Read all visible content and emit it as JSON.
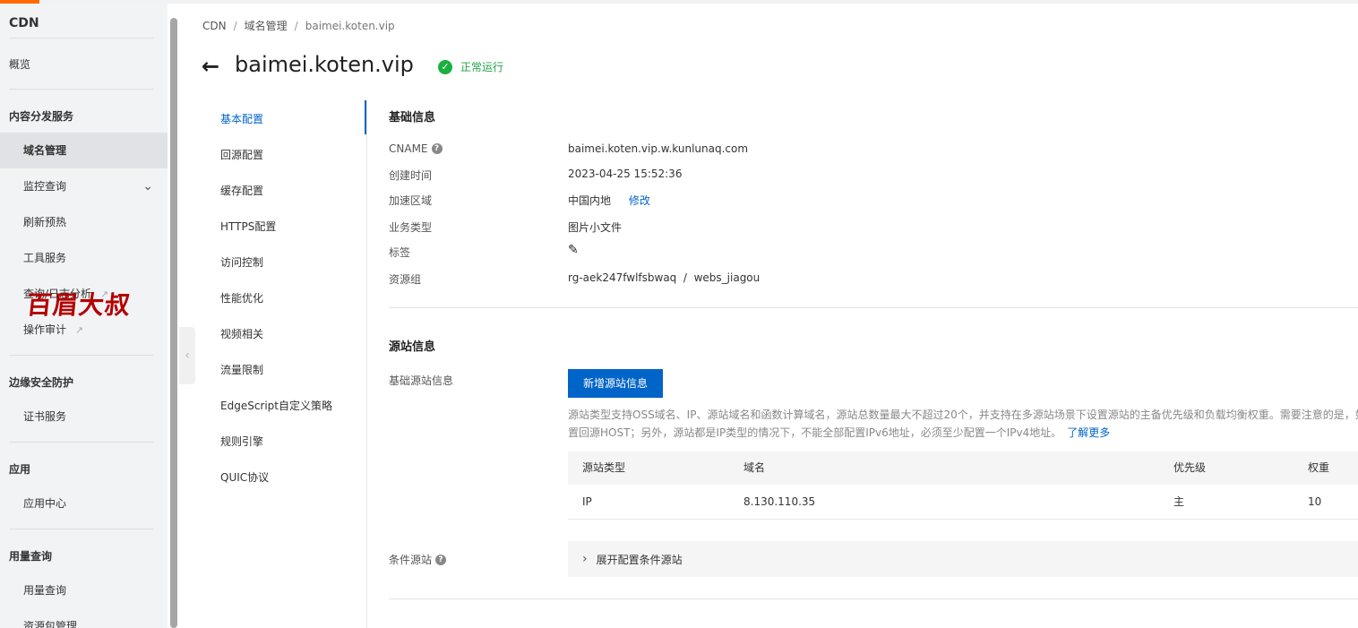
{
  "sidebar": {
    "title": "CDN",
    "overview": "概览",
    "groups": {
      "content": "内容分发服务",
      "edge": "边缘安全防护",
      "apps": "应用",
      "usage": "用量查询"
    },
    "items": {
      "domain": "域名管理",
      "monitor": "监控查询",
      "refresh": "刷新预热",
      "tools": "工具服务",
      "log": "查询/日志分析",
      "audit": "操作审计",
      "cert": "证书服务",
      "appcenter": "应用中心",
      "usagequery": "用量查询",
      "resource": "资源包管理"
    },
    "watermark": "百眉大叔"
  },
  "breadcrumb": {
    "root": "CDN",
    "mid": "域名管理",
    "current": "baimei.koten.vip"
  },
  "header": {
    "title": "baimei.koten.vip",
    "status": "正常运行",
    "status_color": "#1ab03e"
  },
  "config_nav": [
    "基本配置",
    "回源配置",
    "缓存配置",
    "HTTPS配置",
    "访问控制",
    "性能优化",
    "视频相关",
    "流量限制",
    "EdgeScript自定义策略",
    "规则引擎",
    "QUIC协议"
  ],
  "basic": {
    "title": "基础信息",
    "labels": {
      "cname": "CNAME",
      "created": "创建时间",
      "region": "加速区域",
      "biz": "业务类型",
      "tags": "标签",
      "rg": "资源组"
    },
    "values": {
      "cname": "baimei.koten.vip.w.kunlunaq.com",
      "created": "2023-04-25 15:52:36",
      "region": "中国内地",
      "region_edit": "修改",
      "biz": "图片小文件",
      "rg": "rg-aek247fwlfsbwaq  /  webs_jiagou"
    }
  },
  "origin": {
    "title": "源站信息",
    "basic_label": "基础源站信息",
    "add_button": "新增源站信息",
    "desc_line1": "源站类型支持OSS域名、IP、源站域名和函数计算域名，源站总数量最大不超过20个，并支持在多源站场景下设置源站的主备优先级和负载均衡权重。需要注意的是，如",
    "desc_line2": "置回源HOST；另外，源站都是IP类型的情况下，不能全部配置IPv6地址，必须至少配置一个IPv4地址。",
    "learn_more": "了解更多",
    "table": {
      "headers": [
        "源站类型",
        "域名",
        "优先级",
        "权重"
      ],
      "rows": [
        [
          "IP",
          "8.130.110.35",
          "主",
          "10"
        ]
      ]
    },
    "cond_label": "条件源站",
    "cond_expand": "展开配置条件源站"
  },
  "colors": {
    "accent": "#0064c8",
    "brand": "#ff6a00"
  }
}
